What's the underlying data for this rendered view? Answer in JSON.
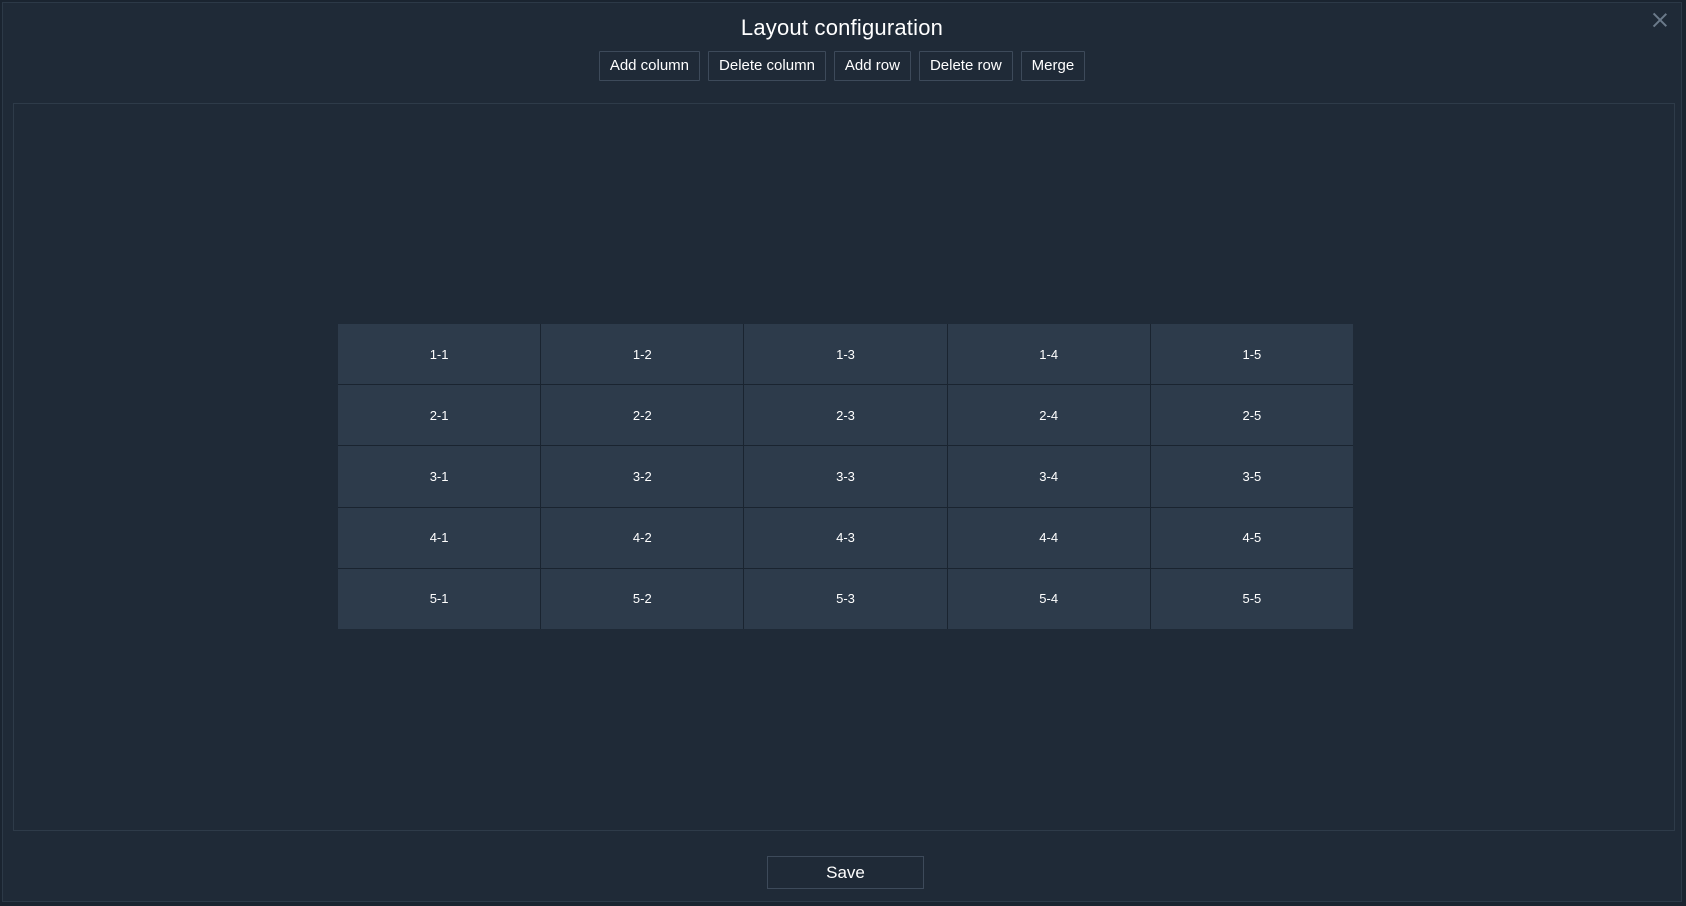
{
  "dialog": {
    "title": "Layout configuration"
  },
  "toolbar": {
    "add_column": "Add column",
    "delete_column": "Delete column",
    "add_row": "Add row",
    "delete_row": "Delete row",
    "merge": "Merge"
  },
  "grid": {
    "rows": 5,
    "columns": 5,
    "cells": [
      [
        "1-1",
        "1-2",
        "1-3",
        "1-4",
        "1-5"
      ],
      [
        "2-1",
        "2-2",
        "2-3",
        "2-4",
        "2-5"
      ],
      [
        "3-1",
        "3-2",
        "3-3",
        "3-4",
        "3-5"
      ],
      [
        "4-1",
        "4-2",
        "4-3",
        "4-4",
        "4-5"
      ],
      [
        "5-1",
        "5-2",
        "5-3",
        "5-4",
        "5-5"
      ]
    ]
  },
  "footer": {
    "save_label": "Save"
  },
  "icons": {
    "close": "close-icon"
  },
  "colors": {
    "background": "#1f2a37",
    "cell": "#2d3b4b",
    "text": "#ffffff",
    "border": "#3d4a5a"
  }
}
